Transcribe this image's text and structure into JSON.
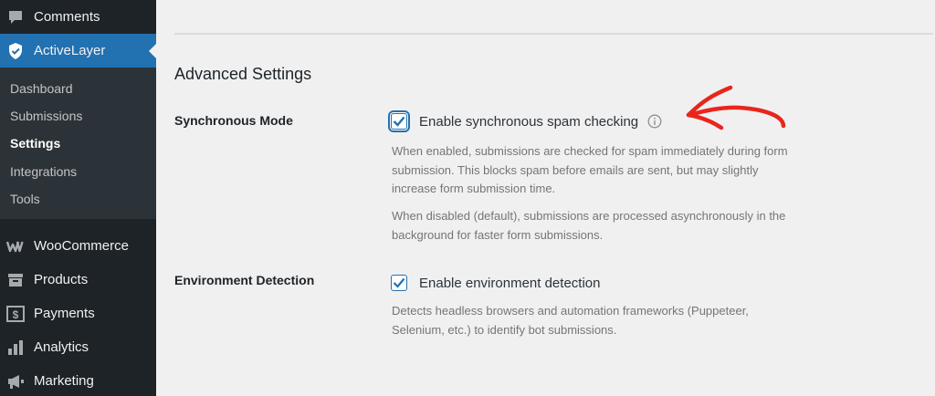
{
  "sidebar": {
    "comments": {
      "label": "Comments",
      "icon": "comment-icon"
    },
    "activelayer": {
      "label": "ActiveLayer",
      "icon": "shield-check-icon"
    },
    "submenu": [
      "Dashboard",
      "Submissions",
      "Settings",
      "Integrations",
      "Tools"
    ],
    "current_submenu": "Settings",
    "woocommerce": {
      "label": "WooCommerce",
      "icon": "woocommerce-icon"
    },
    "products": {
      "label": "Products",
      "icon": "archive-icon"
    },
    "payments": {
      "label": "Payments",
      "icon": "dollar-icon"
    },
    "analytics": {
      "label": "Analytics",
      "icon": "bar-chart-icon"
    },
    "marketing": {
      "label": "Marketing",
      "icon": "megaphone-icon"
    }
  },
  "main": {
    "section_title": "Advanced Settings",
    "sync": {
      "label": "Synchronous Mode",
      "checkbox_label": "Enable synchronous spam checking",
      "checked": true,
      "desc1": "When enabled, submissions are checked for spam immediately during form submission. This blocks spam before emails are sent, but may slightly increase form submission time.",
      "desc2": "When disabled (default), submissions are processed asynchronously in the background for faster form submissions."
    },
    "env": {
      "label": "Environment Detection",
      "checkbox_label": "Enable environment detection",
      "checked": true,
      "desc": "Detects headless browsers and automation frameworks (Puppeteer, Selenium, etc.) to identify bot submissions."
    }
  },
  "colors": {
    "accent": "#2271b1",
    "sidebar": "#1d2327",
    "annotation": "#e8261c"
  }
}
